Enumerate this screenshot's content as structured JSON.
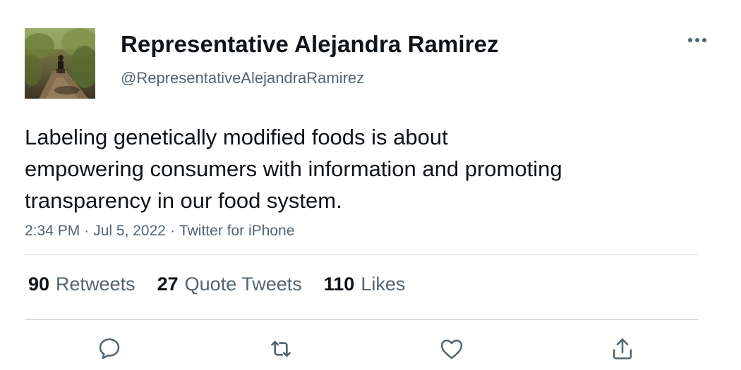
{
  "author": {
    "display_name": "Representative Alejandra Ramirez",
    "handle": "@RepresentativeAlejandraRamirez",
    "avatar_icon": "profile-photo-outdoor-path"
  },
  "tweet": {
    "text": "Labeling genetically modified foods is about\nempowering consumers with information and promoting\ntransparency in our food system.",
    "time": "2:34 PM",
    "date": "Jul 5, 2022",
    "source": "Twitter for iPhone",
    "separator": "·"
  },
  "stats": {
    "retweets": {
      "count": "90",
      "label": "Retweets"
    },
    "quote_tweets": {
      "count": "27",
      "label": "Quote Tweets"
    },
    "likes": {
      "count": "110",
      "label": "Likes"
    }
  },
  "actions": {
    "reply_icon": "reply-icon",
    "retweet_icon": "retweet-icon",
    "like_icon": "heart-icon",
    "share_icon": "share-icon"
  },
  "colors": {
    "text_primary": "#0f1419",
    "text_secondary": "#536471",
    "divider": "#cfd9de",
    "icon": "#536471"
  }
}
